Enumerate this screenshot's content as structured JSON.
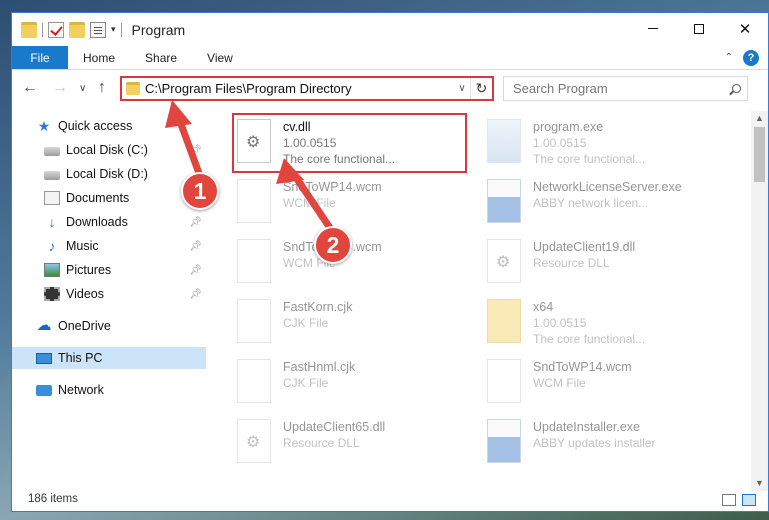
{
  "window": {
    "title": "Program",
    "qat_dropdown": "▾"
  },
  "ribbon": {
    "tabs": [
      {
        "label": "File"
      },
      {
        "label": "Home"
      },
      {
        "label": "Share"
      },
      {
        "label": "View"
      }
    ],
    "collapse_glyph": "⌃",
    "help_glyph": "?"
  },
  "address": {
    "path": "C:\\Program Files\\Program Directory",
    "search_placeholder": "Search Program"
  },
  "sidebar": {
    "items": [
      {
        "label": "Quick access",
        "icon": "star-icon",
        "pinned": false
      },
      {
        "label": "Local Disk (C:)",
        "icon": "drive-icon",
        "pinned": true
      },
      {
        "label": "Local Disk (D:)",
        "icon": "drive-icon",
        "pinned": false
      },
      {
        "label": "Documents",
        "icon": "documents-icon",
        "pinned": true
      },
      {
        "label": "Downloads",
        "icon": "downloads-icon",
        "pinned": true
      },
      {
        "label": "Music",
        "icon": "music-icon",
        "pinned": true
      },
      {
        "label": "Pictures",
        "icon": "pictures-icon",
        "pinned": true
      },
      {
        "label": "Videos",
        "icon": "videos-icon",
        "pinned": true
      },
      {
        "label": "OneDrive",
        "icon": "onedrive-icon",
        "pinned": false
      },
      {
        "label": "This PC",
        "icon": "this-pc-icon",
        "pinned": false,
        "selected": true
      },
      {
        "label": "Network",
        "icon": "network-icon",
        "pinned": false
      }
    ]
  },
  "files": [
    {
      "name": "cv.dll",
      "line2": "1.00.0515",
      "line3": "The core functional...",
      "icon": "dll-file-icon",
      "highlighted": true
    },
    {
      "name": "program.exe",
      "line2": "1.00.0515",
      "line3": "The core functional...",
      "icon": "exe-file-icon"
    },
    {
      "name": "SndToWP14.wcm",
      "line2": "WCM File",
      "icon": "blank-file-icon"
    },
    {
      "name": "NetworkLicenseServer.exe",
      "line2": "ABBY network licen...",
      "icon": "exe-file-icon"
    },
    {
      "name": "SndToWP14.wcm",
      "line2": "WCM File",
      "icon": "blank-file-icon"
    },
    {
      "name": "UpdateClient19.dll",
      "line2": "Resource DLL",
      "icon": "dll-file-icon"
    },
    {
      "name": "FastKorn.cjk",
      "line2": "CJK File",
      "icon": "blank-file-icon"
    },
    {
      "name": "x64",
      "line2": "1.00.0515",
      "line3": "The core functional...",
      "icon": "folder-icon"
    },
    {
      "name": "FastHnml.cjk",
      "line2": "CJK File",
      "icon": "blank-file-icon"
    },
    {
      "name": "SndToWP14.wcm",
      "line2": "WCM File",
      "icon": "blank-file-icon"
    },
    {
      "name": "UpdateClient65.dll",
      "line2": "Resource DLL",
      "icon": "dll-file-icon"
    },
    {
      "name": "UpdateInstaller.exe",
      "line2": "ABBY updates installer",
      "icon": "exe-file-icon"
    }
  ],
  "status": {
    "item_count": "186 items"
  },
  "annotations": [
    {
      "number": "1"
    },
    {
      "number": "2"
    }
  ],
  "colors": {
    "accent": "#1979ca",
    "highlight_red": "#d9363e",
    "badge_red": "#e0463e"
  }
}
